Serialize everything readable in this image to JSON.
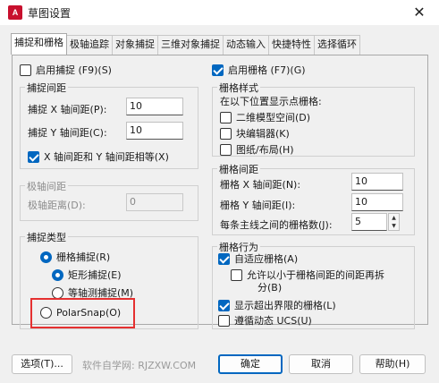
{
  "window": {
    "title": "草图设置",
    "icon_text": "A",
    "close_glyph": "✕"
  },
  "tabs": [
    {
      "label": "捕捉和栅格"
    },
    {
      "label": "极轴追踪"
    },
    {
      "label": "对象捕捉"
    },
    {
      "label": "三维对象捕捉"
    },
    {
      "label": "动态输入"
    },
    {
      "label": "快捷特性"
    },
    {
      "label": "选择循环"
    }
  ],
  "snap": {
    "enable_label": "启用捕捉 (F9)(S)",
    "enable_checked": false,
    "spacing_group": "捕捉间距",
    "x_label": "捕捉 X 轴间距(P):",
    "x_value": "10",
    "y_label": "捕捉 Y 轴间距(C):",
    "y_value": "10",
    "equal_label": "X 轴间距和 Y 轴间距相等(X)",
    "equal_checked": true,
    "polar_group": "极轴间距",
    "polar_label": "极轴距离(D):",
    "polar_value": "0",
    "type_group": "捕捉类型",
    "grid_snap_label": "栅格捕捉(R)",
    "rect_snap_label": "矩形捕捉(E)",
    "iso_snap_label": "等轴测捕捉(M)",
    "polarsnap_label": "PolarSnap(O)"
  },
  "grid": {
    "enable_label": "启用栅格 (F7)(G)",
    "enable_checked": true,
    "style_group": "栅格样式",
    "style_desc": "在以下位置显示点栅格:",
    "model_label": "二维模型空间(D)",
    "block_label": "块编辑器(K)",
    "sheet_label": "图纸/布局(H)",
    "spacing_group": "栅格间距",
    "x_label": "栅格 X 轴间距(N):",
    "x_value": "10",
    "y_label": "栅格 Y 轴间距(I):",
    "y_value": "10",
    "major_label": "每条主线之间的栅格数(J):",
    "major_value": "5",
    "behavior_group": "栅格行为",
    "adaptive_label": "自适应栅格(A)",
    "adaptive_checked": true,
    "subdivide_label_1": "允许以小于栅格间距的间距再拆",
    "subdivide_label_2": "分(B)",
    "beyond_label": "显示超出界限的栅格(L)",
    "beyond_checked": true,
    "follow_label": "遵循动态 UCS(U)",
    "follow_checked": false
  },
  "footer": {
    "options_label": "选项(T)...",
    "watermark": "软件自学网: RJZXW.COM",
    "ok_label": "确定",
    "cancel_label": "取消",
    "help_label": "帮助(H)"
  }
}
